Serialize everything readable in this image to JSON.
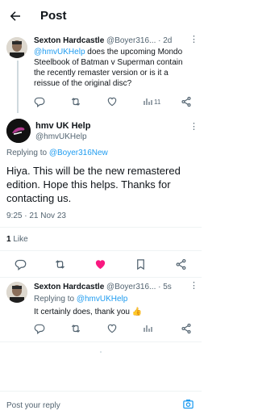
{
  "header": {
    "title": "Post"
  },
  "tweet1": {
    "name": "Sexton Hardcastle",
    "handle": "@Boyer316...",
    "time": "· 2d",
    "mention": "@hmvUKHelp",
    "text_rest": " does the upcoming Mondo Steelbook of Batman v Superman contain the recently remaster version or is it a reissue of the original disc?",
    "views": "11"
  },
  "main": {
    "name": "hmv UK Help",
    "handle": "@hmvUKHelp",
    "replying_prefix": "Replying to ",
    "replying_to": "@Boyer316New",
    "text": "Hiya. This will be the new remastered edition. Hope this helps. Thanks for contacting us.",
    "timestamp": "9:25 · 21 Nov 23",
    "likes_count": "1",
    "likes_label": " Like"
  },
  "tweet3": {
    "name": "Sexton Hardcastle",
    "handle": "@Boyer316...",
    "time": "· 5s",
    "replying_prefix": "Replying to ",
    "replying_to": "@hmvUKHelp",
    "text": "It certainly does, thank you 👍"
  },
  "reply_box": {
    "placeholder": "Post your reply"
  },
  "colors": {
    "accent": "#1d9bf0",
    "like": "#f91880",
    "muted": "#536471"
  }
}
